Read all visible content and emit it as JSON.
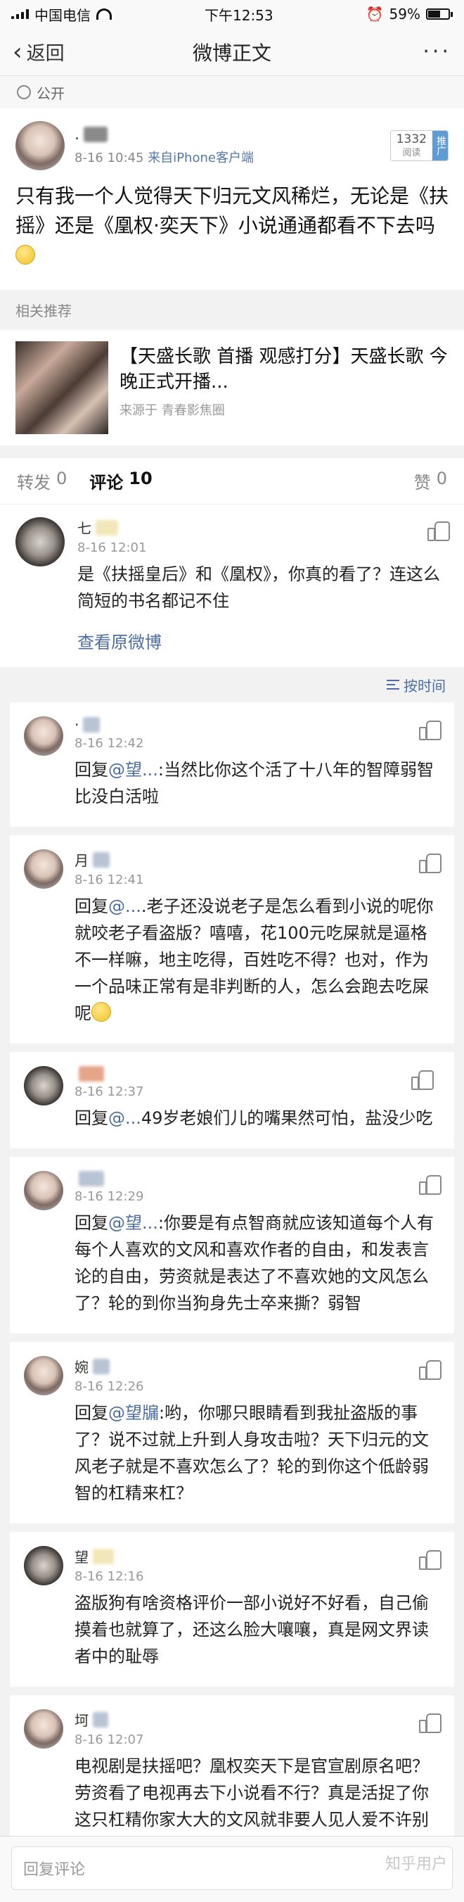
{
  "status_bar": {
    "carrier": "中国电信",
    "time": "下午12:53",
    "battery": "59%",
    "battery_fraction": 0.59
  },
  "nav": {
    "back_label": "返回",
    "title": "微博正文",
    "more_label": "···"
  },
  "visibility": {
    "label": "公开"
  },
  "post": {
    "author_initial": ".",
    "time": "8-16 10:45",
    "source": "来自iPhone客户端",
    "views_count": "1332",
    "views_label": "阅读",
    "promote_label": "推广",
    "text": "只有我一个人觉得天下归元文风稀烂，无论是《扶摇》还是《凰权·奕天下》小说通通都看不下去吗"
  },
  "related": {
    "section_label": "相关推荐",
    "title": "【天盛长歌 首播 观感打分】天盛长歌 今晚正式开播...",
    "source": "来源于 青春影焦圈"
  },
  "tabs": {
    "repost_label": "转发",
    "repost_count": "0",
    "comment_label": "评论",
    "comment_count": "10",
    "like_label": "赞",
    "like_count": "0"
  },
  "hot_comment": {
    "name_initial": "七",
    "time": "8-16 12:01",
    "text": "是《扶摇皇后》和《凰权》，你真的看了？连这么简短的书名都记不住",
    "view_original": "查看原微博"
  },
  "sort_label": "按时间",
  "replies": [
    {
      "name_initial": "·",
      "time": "8-16 12:42",
      "prefix": "回复",
      "mention": "@望...",
      "text": ":当然比你这个活了十八年的智障弱智比没白活啦"
    },
    {
      "name_initial": "月",
      "time": "8-16 12:41",
      "prefix": "回复",
      "mention": "@...",
      "text": ".老子还没说老子是怎么看到小说的呢你就咬老子看盗版？嘻嘻，花100元吃屎就是逼格不一样嘛，地主吃得，百姓吃不得？也对，作为一个品味正常有是非判断的人，怎么会跑去吃屎呢"
    },
    {
      "name_initial": "",
      "time": "8-16 12:37",
      "prefix": "回复",
      "mention": "@...",
      "text": "49岁老娘们儿的嘴果然可怕，盐没少吃"
    },
    {
      "name_initial": "",
      "time": "8-16 12:29",
      "prefix": "回复",
      "mention": "@望...",
      "text": ":你要是有点智商就应该知道每个人有每个人喜欢的文风和喜欢作者的自由，和发表言论的自由，劳资就是表达了不喜欢她的文风怎么了？轮的到你当狗身先士卒来撕？弱智"
    },
    {
      "name_initial": "婉",
      "time": "8-16 12:26",
      "prefix": "回复",
      "mention": "@望牖",
      "text": ":哟，你哪只眼睛看到我扯盗版的事了？说不过就上升到人身攻击啦？天下归元的文风老子就是不喜欢怎么了？轮的到你这个低龄弱智的杠精来杠？"
    },
    {
      "name_initial": "望",
      "time": "8-16 12:16",
      "prefix": "",
      "mention": "",
      "text": "盗版狗有啥资格评价一部小说好不好看，自己偷摸着也就算了，还这么脸大嚷嚷，真是网文界读者中的耻辱"
    },
    {
      "name_initial": "坷",
      "time": "8-16 12:07",
      "prefix": "",
      "mention": "",
      "text": "电视剧是扶摇吧？凰权奕天下是官宣剧原名吧？劳资看了电视再去下小说看不行？真是活捉了你这只杠精你家大大的文风就非要人见人爱不许别人不喜欢？不喜欢她文风怎么了？经你这么一杠我还要对她路转黑呢怎么了？？"
    }
  ],
  "bottom": {
    "placeholder": "回复评论",
    "watermark": "知乎用户"
  }
}
